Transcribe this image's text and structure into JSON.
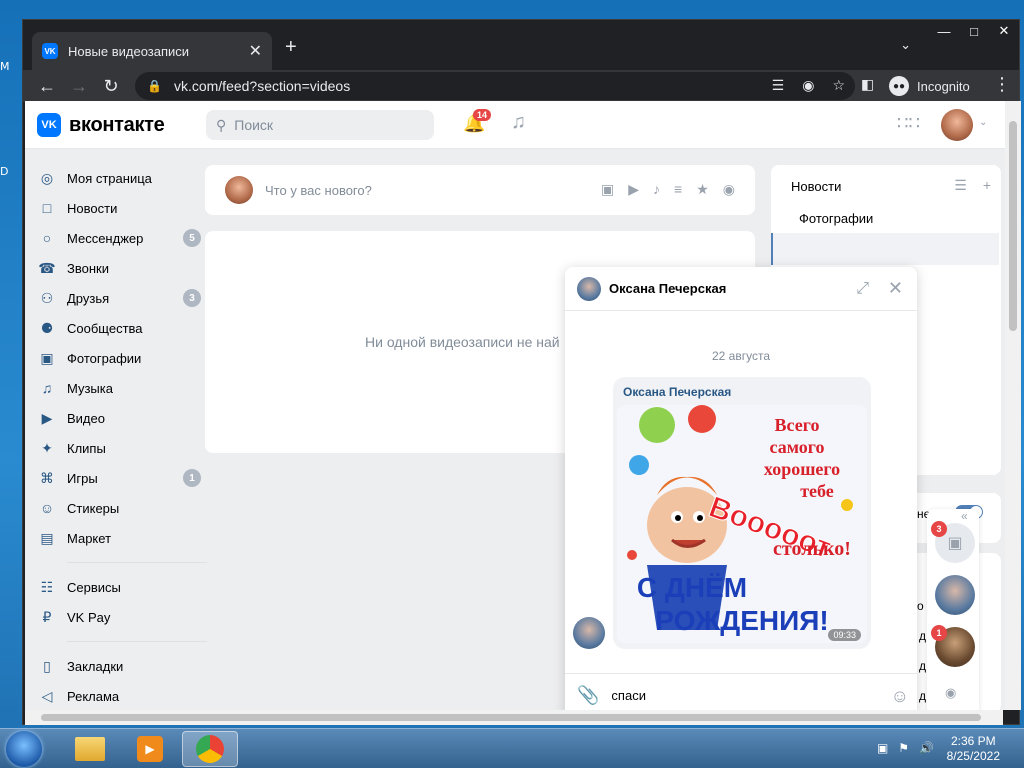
{
  "browser": {
    "tab_title": "Новые видеозаписи",
    "tab_icon": "vk-favicon",
    "url": "vk.com/feed?section=videos",
    "profile_label": "Incognito"
  },
  "vk": {
    "logo_text": "вконтакте",
    "search_placeholder": "Поиск",
    "notification_count": "14",
    "nav": [
      {
        "label": "Моя страница",
        "icon": "user-circle-icon"
      },
      {
        "label": "Новости",
        "icon": "newsfeed-icon"
      },
      {
        "label": "Мессенджер",
        "icon": "message-icon",
        "count": "5"
      },
      {
        "label": "Звонки",
        "icon": "phone-icon"
      },
      {
        "label": "Друзья",
        "icon": "friends-icon",
        "count": "3"
      },
      {
        "label": "Сообщества",
        "icon": "communities-icon"
      },
      {
        "label": "Фотографии",
        "icon": "photo-icon"
      },
      {
        "label": "Музыка",
        "icon": "music-icon"
      },
      {
        "label": "Видео",
        "icon": "video-icon"
      },
      {
        "label": "Клипы",
        "icon": "clips-icon"
      },
      {
        "label": "Игры",
        "icon": "games-icon",
        "count": "1"
      },
      {
        "label": "Стикеры",
        "icon": "stickers-icon"
      },
      {
        "label": "Маркет",
        "icon": "market-icon"
      }
    ],
    "nav2": [
      {
        "label": "Сервисы",
        "icon": "services-icon"
      },
      {
        "label": "VK Pay",
        "icon": "vkpay-icon"
      }
    ],
    "nav3": [
      {
        "label": "Закладки",
        "icon": "bookmark-icon"
      },
      {
        "label": "Реклама",
        "icon": "ads-icon"
      }
    ],
    "composer_placeholder": "Что у вас нового?",
    "empty_text": "Ни одной видеозаписи не най",
    "right_menu": {
      "title": "Новости",
      "item": "Фотографии"
    },
    "right_fragments": [
      "не",
      "о",
      "д",
      "д",
      "д"
    ]
  },
  "chat": {
    "name": "Оксана Печерская",
    "date": "22 августа",
    "sender": "Оксана Печерская",
    "time": "09:33",
    "card_lines": [
      "Всего",
      "самого",
      "хорошего",
      "тебе",
      "Вооооот",
      "столько!",
      "С ДНЁМ",
      "РОЖДЕНИЯ!"
    ],
    "input_value": "спаси"
  },
  "chat_rail": {
    "badges": [
      "3",
      "1"
    ]
  },
  "taskbar": {
    "time": "2:36 PM",
    "date": "8/25/2022"
  },
  "desktop_labels": [
    "M",
    "D"
  ],
  "colors": {
    "vk_blue": "#0077ff",
    "badge_red": "#e64646"
  }
}
